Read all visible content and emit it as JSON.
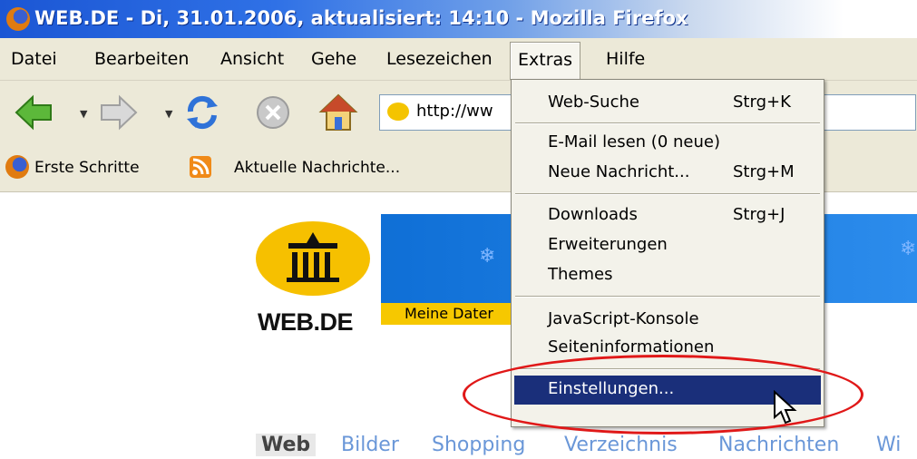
{
  "window": {
    "title": "WEB.DE - Di, 31.01.2006, aktualisiert: 14:10 - Mozilla Firefox"
  },
  "menubar": {
    "items": [
      {
        "label": "Datei"
      },
      {
        "label": "Bearbeiten"
      },
      {
        "label": "Ansicht"
      },
      {
        "label": "Gehe"
      },
      {
        "label": "Lesezeichen"
      },
      {
        "label": "Extras"
      },
      {
        "label": "Hilfe"
      }
    ]
  },
  "toolbar": {
    "url": "http://ww",
    "icons": [
      "back-icon",
      "forward-icon",
      "reload-icon",
      "stop-icon",
      "home-icon"
    ]
  },
  "bookmarks": {
    "items": [
      {
        "label": "Erste Schritte",
        "icon": "firefox-icon"
      },
      {
        "label": "Aktuelle Nachrichte...",
        "icon": "rss-icon"
      }
    ]
  },
  "page": {
    "logo_text": "WEB.DE",
    "yellow_strip": "Meine Dater",
    "nav": [
      {
        "label": "Web"
      },
      {
        "label": "Bilder"
      },
      {
        "label": "Shopping"
      },
      {
        "label": "Verzeichnis"
      },
      {
        "label": "Nachrichten"
      },
      {
        "label": "Wi"
      }
    ]
  },
  "dropdown": {
    "items": [
      {
        "label": "Web-Suche",
        "shortcut": "Strg+K"
      },
      {
        "label": "E-Mail lesen (0 neue)",
        "shortcut": ""
      },
      {
        "label": "Neue Nachricht...",
        "shortcut": "Strg+M"
      },
      {
        "label": "Downloads",
        "shortcut": "Strg+J"
      },
      {
        "label": "Erweiterungen",
        "shortcut": ""
      },
      {
        "label": "Themes",
        "shortcut": ""
      },
      {
        "label": "JavaScript-Konsole",
        "shortcut": ""
      },
      {
        "label": "Seiteninformationen",
        "shortcut": ""
      },
      {
        "label": "Einstellungen...",
        "shortcut": ""
      }
    ],
    "highlighted": "Einstellungen..."
  },
  "colors": {
    "highlight": "#1a2f7a",
    "annotation": "#e01818",
    "brand_yellow": "#f6c000"
  }
}
